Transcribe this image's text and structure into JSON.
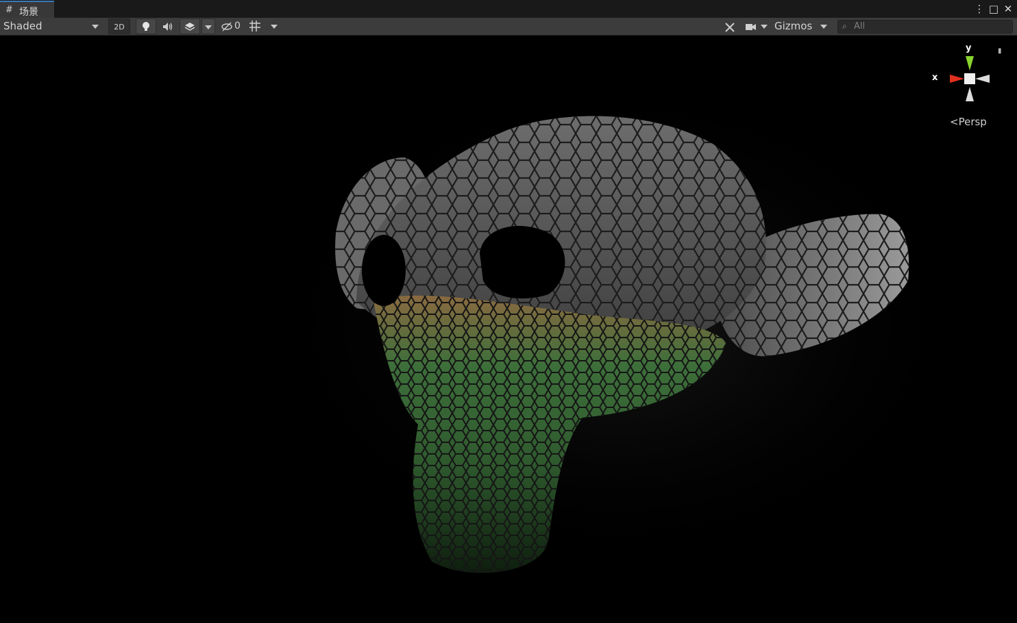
{
  "window": {
    "tab_label": "场景",
    "tab_icon": "grid-icon",
    "menu_icon_glyph": "⋮",
    "maximize_icon_glyph": "□",
    "close_icon_glyph": "✕"
  },
  "toolbar": {
    "shading_mode": "Shaded",
    "btn_2d": "2D",
    "hidden_count": "0",
    "gizmos_label": "Gizmos",
    "search_placeholder": "All"
  },
  "scene_gizmo": {
    "x_label": "x",
    "y_label": "y",
    "projection_label": "Persp",
    "colors": {
      "x": "#e0301e",
      "y": "#8ad42e",
      "z": "#dcdcdc"
    }
  },
  "colors": {
    "tab_accent": "#3a79bb",
    "toolbar_bg": "#3c3c3c",
    "tabbar_bg": "#191919",
    "viewport_bg": "#000000"
  }
}
